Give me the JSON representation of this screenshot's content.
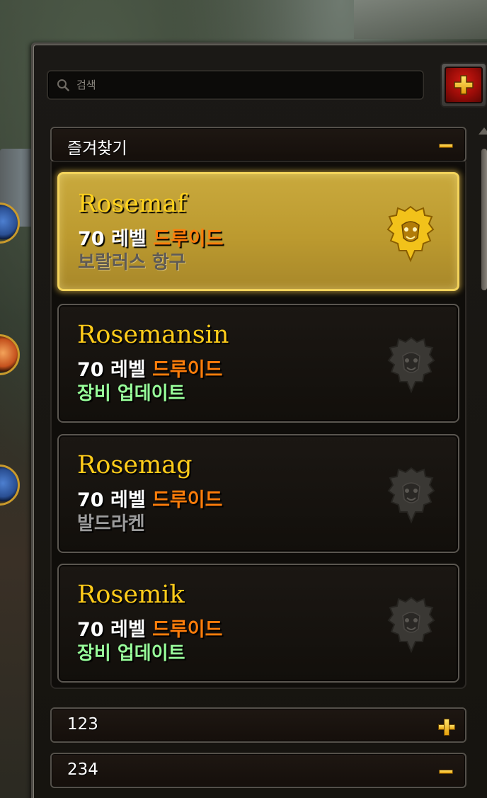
{
  "search": {
    "placeholder": "검색",
    "value": ""
  },
  "add_button": {
    "icon": "plus-icon"
  },
  "groups": [
    {
      "title": "즐겨찾기",
      "state": "expanded"
    },
    {
      "title": "123",
      "state": "collapsed"
    },
    {
      "title": "234",
      "state": "expanded"
    }
  ],
  "characters": [
    {
      "name": "Rosemaf",
      "level": "70 레벨",
      "class": "드루이드",
      "location": "보랄러스 항구",
      "selected": true,
      "faction_icon": "alliance-lion-icon"
    },
    {
      "name": "Rosemansin",
      "level": "70 레벨",
      "class": "드루이드",
      "location": "장비 업데이트",
      "selected": false,
      "faction_icon": "alliance-lion-icon"
    },
    {
      "name": "Rosemag",
      "level": "70 레벨",
      "class": "드루이드",
      "location": "발드라켄",
      "selected": false,
      "faction_icon": "alliance-lion-icon"
    },
    {
      "name": "Rosemik",
      "level": "70 레벨",
      "class": "드루이드",
      "location": "장비 업데이트",
      "selected": false,
      "faction_icon": "alliance-lion-icon"
    }
  ],
  "colors": {
    "name_gold": "#ffcc1a",
    "class_druid": "#ff7d0a",
    "gear_update_green": "#98ff9a",
    "selected_card_gold": "#c9a93d"
  }
}
